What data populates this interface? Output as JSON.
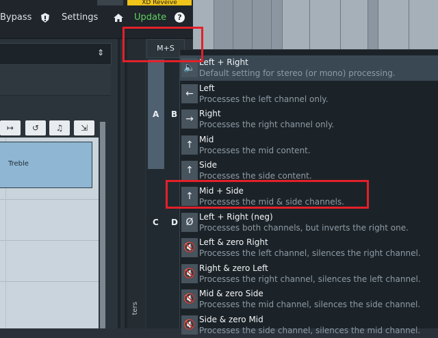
{
  "topbar": {
    "bypass_label": "Bypass",
    "settings_label": "Settings",
    "update_label": "Update",
    "help_label": "?",
    "badge_label": "XD Reveive"
  },
  "plugin": {
    "dropdown_icon": "updown-arrows-icon",
    "toolbar_icons": [
      "fit-icon",
      "undo-icon",
      "import-icon",
      "export-icon"
    ],
    "band_label": "Treble",
    "side_tab_text": "ters"
  },
  "ms": {
    "button_label": "M+S",
    "letters": [
      "A",
      "B",
      "C",
      "D"
    ]
  },
  "menu": {
    "items": [
      {
        "title": "Left + Right",
        "desc": "Default setting for stereo (or mono) processing.",
        "icon": "speaker-icon",
        "glyph": "🔈"
      },
      {
        "title": "Left",
        "desc": "Processes the left channel only.",
        "icon": "arrow-left-icon",
        "glyph": "←"
      },
      {
        "title": "Right",
        "desc": "Processes the right channel only.",
        "icon": "arrow-right-icon",
        "glyph": "→"
      },
      {
        "title": "Mid",
        "desc": "Processes the mid content.",
        "icon": "arrow-up-icon",
        "glyph": "↑"
      },
      {
        "title": "Side",
        "desc": "Processes the side content.",
        "icon": "arrow-up-icon",
        "glyph": "↑"
      },
      {
        "title": "Mid + Side",
        "desc": "Processes the mid & side channels.",
        "icon": "arrow-up-icon",
        "glyph": "↑"
      },
      {
        "title": "Left + Right (neg)",
        "desc": "Processes both channels, but inverts the right one.",
        "icon": "phase-invert-icon",
        "glyph": "Ø"
      },
      {
        "title": "Left & zero Right",
        "desc": "Processes the left channel, silences the right channel.",
        "icon": "mute-icon",
        "glyph": "🔇"
      },
      {
        "title": "Right & zero Left",
        "desc": "Processes the right channel, silences the left channel.",
        "icon": "mute-icon",
        "glyph": "🔇"
      },
      {
        "title": "Mid & zero Side",
        "desc": "Processes the mid channel, silences the side channel.",
        "icon": "mute-icon",
        "glyph": "🔇"
      },
      {
        "title": "Side & zero Mid",
        "desc": "Processes the side channel, silences the mid channel.",
        "icon": "mute-icon",
        "glyph": "🔇"
      }
    ],
    "selected_index": 0
  },
  "colors": {
    "update": "#5fd35f",
    "highlight": "#e4202a",
    "badge": "#f0c419"
  }
}
